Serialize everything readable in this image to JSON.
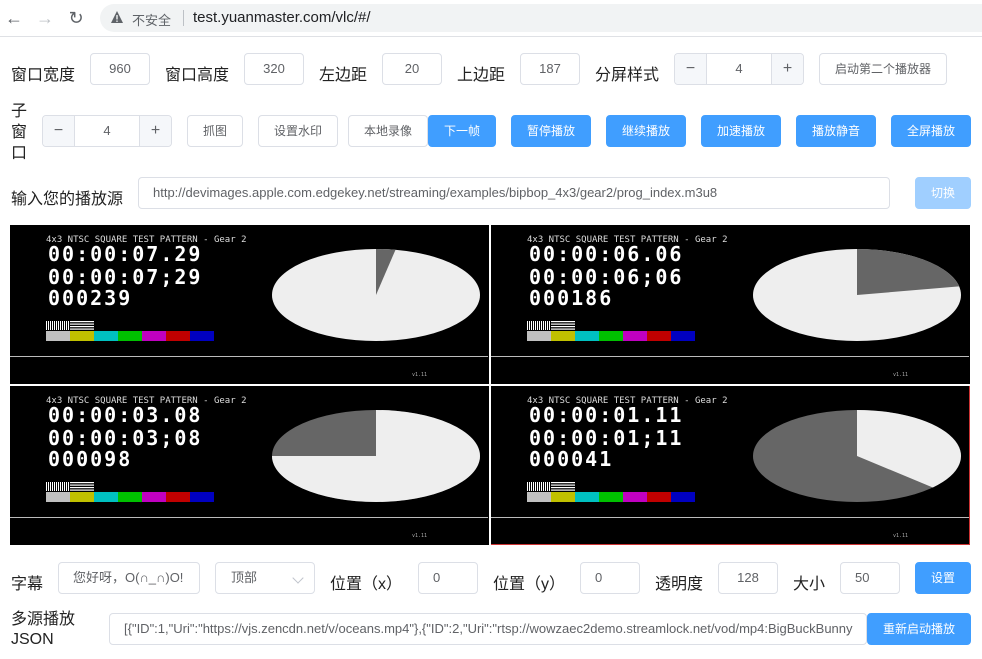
{
  "browser": {
    "insecure_label": "不安全",
    "url": "test.yuanmaster.com/vlc/#/"
  },
  "row1": {
    "width_label": "窗口宽度",
    "width_value": "960",
    "height_label": "窗口高度",
    "height_value": "320",
    "left_label": "左边距",
    "left_value": "20",
    "top_label": "上边距",
    "top_value": "187",
    "split_label": "分屏样式",
    "split_value": "4",
    "second_player_button": "启动第二个播放器"
  },
  "row2": {
    "subwindow_label": "子窗口",
    "subwindow_value": "4",
    "snapshot_button": "抓图",
    "watermark_button": "设置水印",
    "record_button": "本地录像",
    "next_frame_button": "下一帧",
    "pause_button": "暂停播放",
    "resume_button": "继续播放",
    "speed_button": "加速播放",
    "mute_button": "播放静音",
    "fullscreen_button": "全屏播放"
  },
  "source": {
    "label": "输入您的播放源",
    "value": "http://devimages.apple.com.edgekey.net/streaming/examples/bipbop_4x3/gear2/prog_index.m3u8",
    "switch_button": "切换"
  },
  "videos": [
    {
      "title": "4x3 NTSC SQUARE TEST PATTERN - Gear 2",
      "time1": "00:00:07.29",
      "time2": "00:00:07;29",
      "frame": "000239",
      "pie_fraction": 0.03,
      "footer": "v1.11"
    },
    {
      "title": "4x3 NTSC SQUARE TEST PATTERN - Gear 2",
      "time1": "00:00:06.06",
      "time2": "00:00:06;06",
      "frame": "000186",
      "pie_fraction": 0.22,
      "footer": "v1.11"
    },
    {
      "title": "4x3 NTSC SQUARE TEST PATTERN - Gear 2",
      "time1": "00:00:03.08",
      "time2": "00:00:03;08",
      "frame": "000098",
      "pie_fraction": 0.75,
      "footer": "v1.11"
    },
    {
      "title": "4x3 NTSC SQUARE TEST PATTERN - Gear 2",
      "time1": "00:00:01.11",
      "time2": "00:00:01;11",
      "frame": "000041",
      "pie_fraction": 0.37,
      "footer": "v1.11"
    }
  ],
  "colors": {
    "primary": "#409eff",
    "primary_disabled": "#a0cfff",
    "bars": [
      "#c0c0c0",
      "#c0c000",
      "#00c0c0",
      "#00c000",
      "#c000c0",
      "#c00000",
      "#0000c0"
    ]
  },
  "subtitle": {
    "label": "字幕",
    "text_value": "您好呀，O(∩_∩)O!",
    "position_select": "顶部",
    "x_label": "位置（x）",
    "x_value": "0",
    "y_label": "位置（y）",
    "y_value": "0",
    "opacity_label": "透明度",
    "opacity_value": "128",
    "size_label": "大小",
    "size_value": "50",
    "set_button": "设置"
  },
  "multisource": {
    "label": "多源播放JSON",
    "value": "[{\"ID\":1,\"Uri\":\"https://vjs.zencdn.net/v/oceans.mp4\"},{\"ID\":2,\"Uri\":\"rtsp://wowzaec2demo.streamlock.net/vod/mp4:BigBuckBunny",
    "restart_button": "重新启动播放"
  }
}
